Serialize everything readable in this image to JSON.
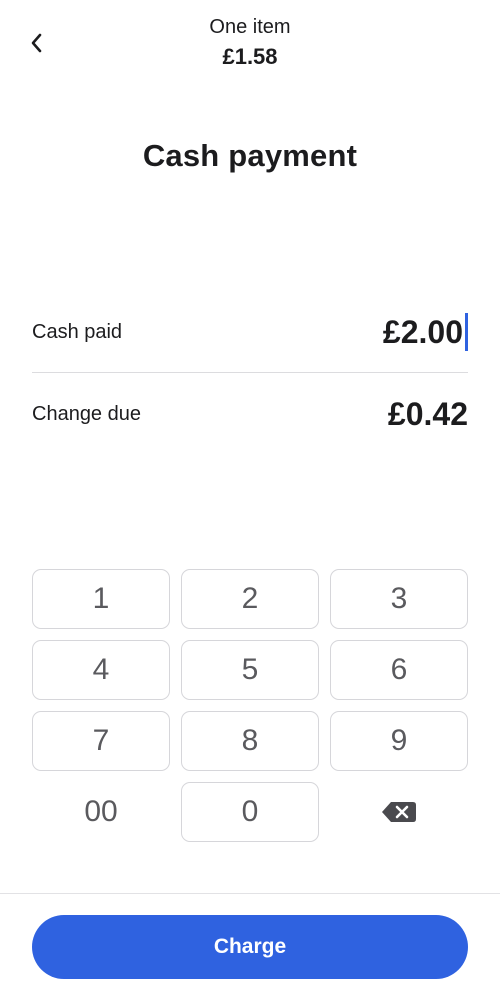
{
  "header": {
    "subtitle": "One item",
    "total": "£1.58"
  },
  "title": "Cash payment",
  "cash_paid": {
    "label": "Cash paid",
    "value": "£2.00"
  },
  "change_due": {
    "label": "Change due",
    "value": "£0.42"
  },
  "keypad": {
    "keys": [
      "1",
      "2",
      "3",
      "4",
      "5",
      "6",
      "7",
      "8",
      "9",
      "00",
      "0"
    ],
    "backspace_icon": "backspace-icon"
  },
  "charge_button": {
    "label": "Charge"
  },
  "colors": {
    "accent": "#2f62e0",
    "text": "#1c1c1e",
    "key_text": "#5a5a5e",
    "key_border": "#d6d6da"
  },
  "icons": {
    "back": "chevron-left-icon",
    "backspace": "backspace-icon"
  }
}
